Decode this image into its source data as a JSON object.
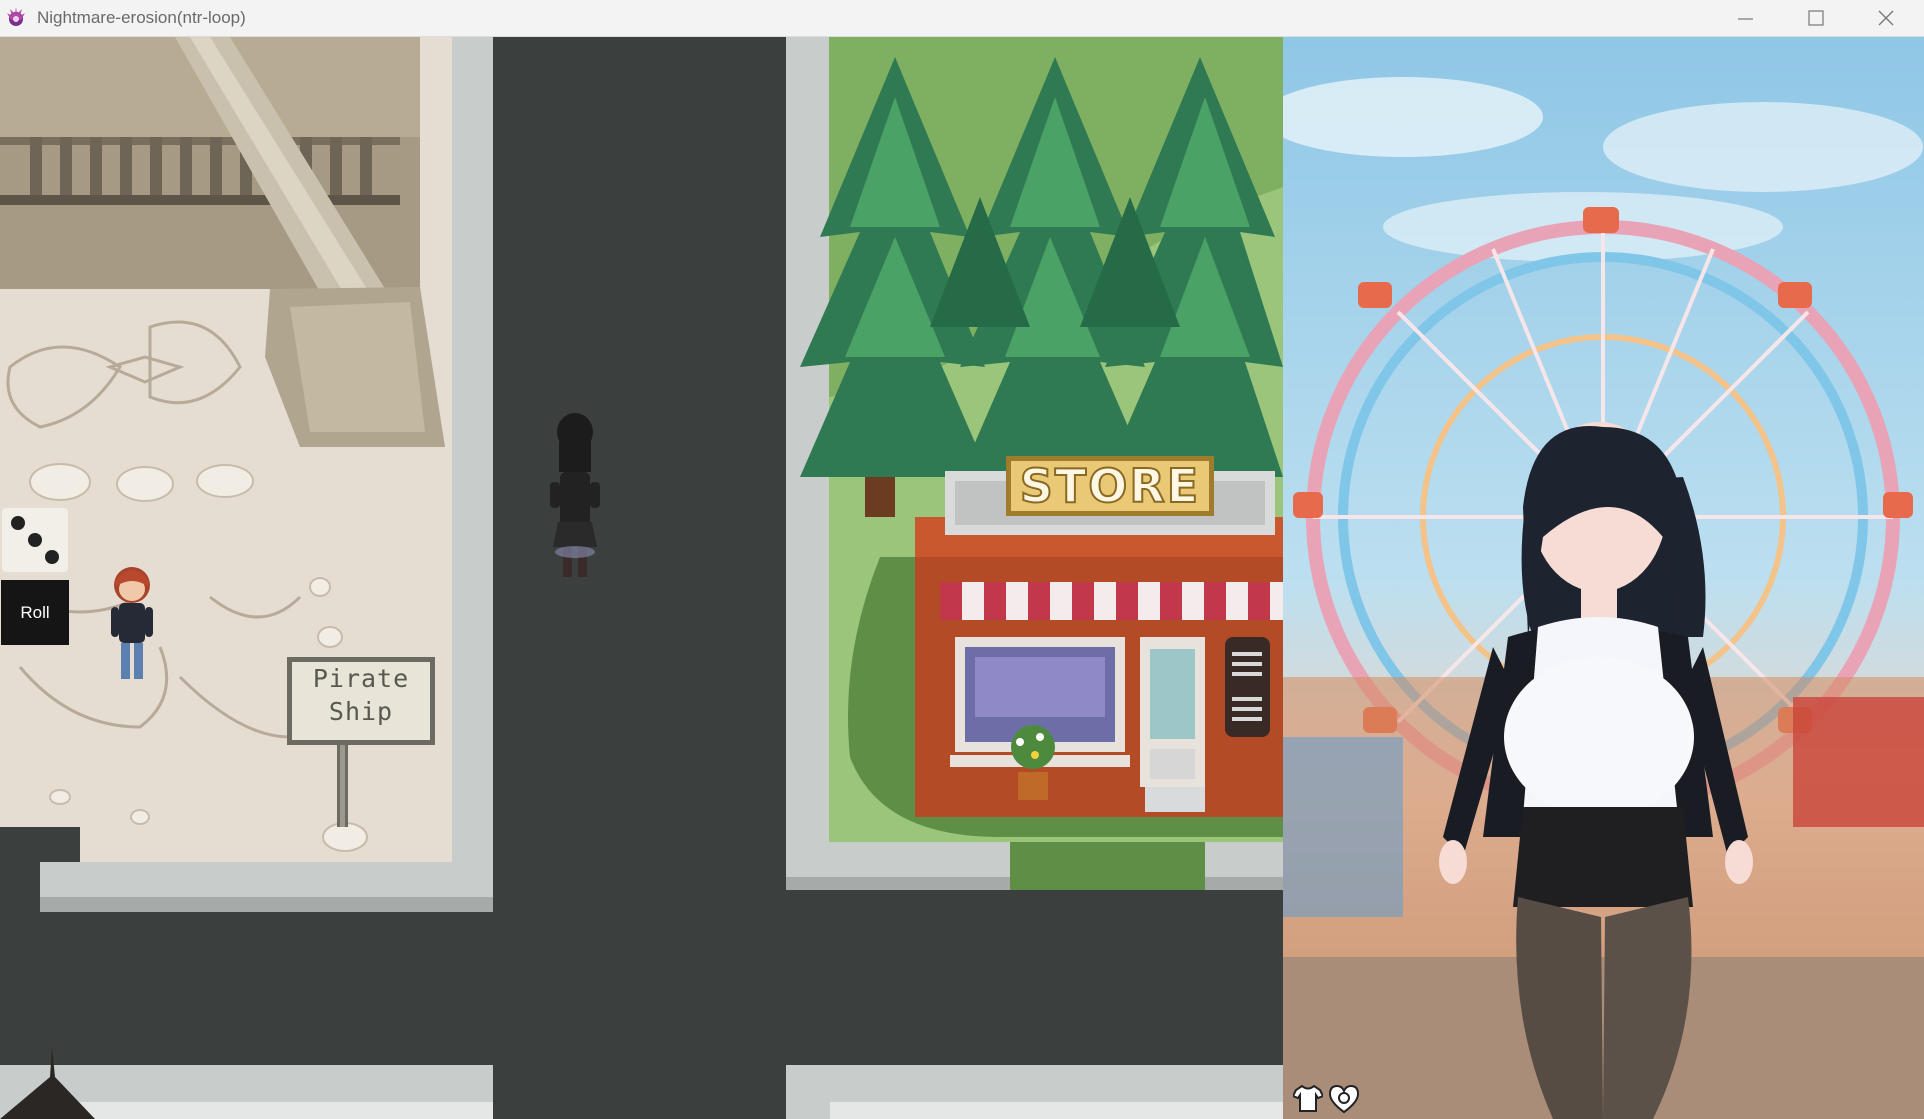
{
  "window": {
    "title": "Nightmare-erosion(ntr-loop)",
    "minimize_icon": "minimize-icon",
    "maximize_icon": "maximize-icon",
    "close_icon": "close-icon"
  },
  "hud": {
    "roll_label": "Roll",
    "die_face": 3,
    "outfit_icon": "shirt-icon",
    "status_icon": "heart-icon"
  },
  "map": {
    "sign_line1": "Pirate",
    "sign_line2": "Ship",
    "store_label": "STORE"
  },
  "colors": {
    "road": "#3b3f3d",
    "sidewalk": "#c8cccb",
    "grass": "#5f8f47",
    "plaza": "#e6ddd2",
    "store_wall": "#b24b26",
    "awning": "#c1384a"
  }
}
